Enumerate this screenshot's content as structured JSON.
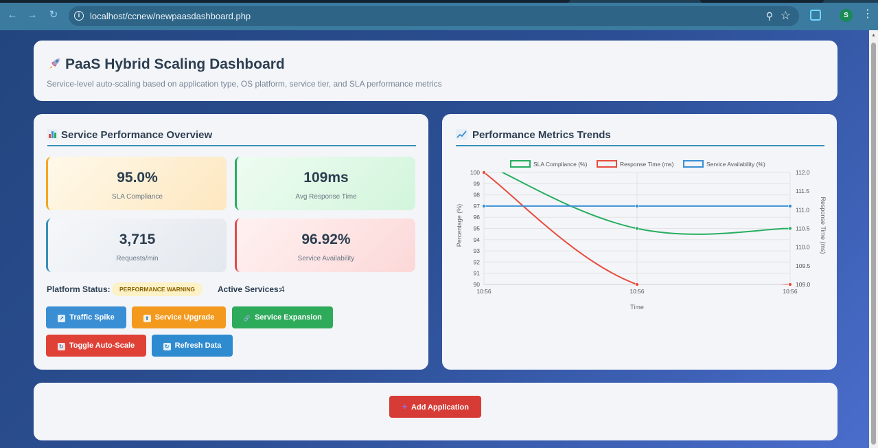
{
  "browser": {
    "url": "localhost/ccnew/newpaasdashboard.php",
    "profile_initial": "S"
  },
  "header": {
    "icon": "rocket-icon",
    "title": "PaaS Hybrid Scaling Dashboard",
    "subtitle": "Service-level auto-scaling based on application type, OS platform, service tier, and SLA performance metrics"
  },
  "overview": {
    "title": "Service Performance Overview",
    "icon": "bar-chart-icon",
    "metrics": [
      {
        "value": "95.0%",
        "label": "SLA Compliance"
      },
      {
        "value": "109ms",
        "label": "Avg Response Time"
      },
      {
        "value": "3,715",
        "label": "Requests/min"
      },
      {
        "value": "96.92%",
        "label": "Service Availability"
      }
    ],
    "platform_status_label": "Platform Status:",
    "platform_status_badge": "PERFORMANCE WARNING",
    "active_services_label": "Active Services:",
    "active_services_value": "4",
    "buttons": {
      "traffic_spike": "Traffic Spike",
      "service_upgrade": "Service Upgrade",
      "service_expansion": "Service Expansion",
      "toggle_auto_scale": "Toggle Auto-Scale",
      "refresh_data": "Refresh Data"
    }
  },
  "trends": {
    "title": "Performance Metrics Trends",
    "icon": "line-chart-icon"
  },
  "chart_data": {
    "type": "line",
    "x": [
      "10:56",
      "10:56",
      "10:56"
    ],
    "xlabel": "Time",
    "ylabel": "Percentage (%)",
    "y2label": "Response Time (ms)",
    "ylim": [
      90,
      100
    ],
    "y2lim": [
      109.0,
      112.0
    ],
    "yticks": [
      "100",
      "99",
      "98",
      "97",
      "96",
      "95",
      "94",
      "93",
      "92",
      "91",
      "90"
    ],
    "y2ticks": [
      "112.0",
      "111.5",
      "111.0",
      "110.5",
      "110.0",
      "109.5",
      "109.0"
    ],
    "legend_position": "top",
    "grid": true,
    "series": [
      {
        "name": "SLA Compliance (%)",
        "axis": "left",
        "color": "#27ae60",
        "values": [
          100.8,
          95.0,
          95.0
        ]
      },
      {
        "name": "Response Time (ms)",
        "axis": "right",
        "color": "#e74c3c",
        "values": [
          112.0,
          109.0,
          109.0
        ]
      },
      {
        "name": "Service Availability (%)",
        "axis": "left",
        "color": "#3a8fd4",
        "values": [
          97.0,
          97.0,
          97.0
        ]
      }
    ]
  },
  "footer": {
    "add_application": "Add Application"
  }
}
